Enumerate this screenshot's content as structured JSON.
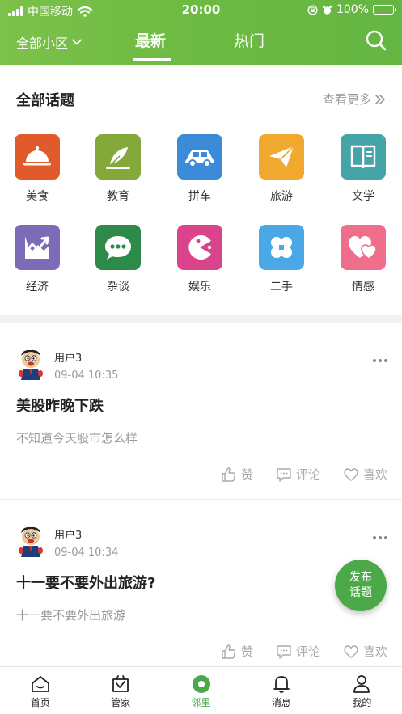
{
  "status_bar": {
    "carrier": "中国移动",
    "time": "20:00",
    "battery": "100%"
  },
  "header": {
    "community": "全部小区",
    "tabs": [
      {
        "label": "最新",
        "active": true
      },
      {
        "label": "热门",
        "active": false
      }
    ]
  },
  "topics": {
    "title": "全部话题",
    "see_more": "查看更多",
    "categories": [
      {
        "label": "美食",
        "icon": "cloche-icon",
        "color": "#e05a2b"
      },
      {
        "label": "教育",
        "icon": "feather-icon",
        "color": "#84a83a"
      },
      {
        "label": "拼车",
        "icon": "car-icon",
        "color": "#3b8bd9"
      },
      {
        "label": "旅游",
        "icon": "paper-plane-icon",
        "color": "#f0a92e"
      },
      {
        "label": "文学",
        "icon": "book-icon",
        "color": "#45a4a8"
      },
      {
        "label": "经济",
        "icon": "trend-chart-icon",
        "color": "#7c6bb6"
      },
      {
        "label": "杂谈",
        "icon": "chat-bubble-icon",
        "color": "#2e8a49"
      },
      {
        "label": "娱乐",
        "icon": "pacman-icon",
        "color": "#d9448a"
      },
      {
        "label": "二手",
        "icon": "clover-icon",
        "color": "#4aa8e6"
      },
      {
        "label": "情感",
        "icon": "hearts-icon",
        "color": "#ef6f8a"
      }
    ]
  },
  "posts": [
    {
      "user": "用户3",
      "time": "09-04 10:35",
      "title": "美股昨晚下跌",
      "body": "不知道今天股市怎么样",
      "actions": {
        "like": "赞",
        "comment": "评论",
        "favorite": "喜欢"
      }
    },
    {
      "user": "用户3",
      "time": "09-04 10:34",
      "title": "十一要不要外出旅游?",
      "body": "十一要不要外出旅游",
      "actions": {
        "like": "赞",
        "comment": "评论",
        "favorite": "喜欢"
      }
    }
  ],
  "fab": {
    "line1": "发布",
    "line2": "话题"
  },
  "bottom_nav": {
    "active_color": "#4ca94a",
    "items": [
      {
        "label": "首页",
        "icon": "home-icon"
      },
      {
        "label": "管家",
        "icon": "butler-icon"
      },
      {
        "label": "邻里",
        "icon": "neighbor-icon",
        "active": true
      },
      {
        "label": "消息",
        "icon": "bell-icon"
      },
      {
        "label": "我的",
        "icon": "person-icon"
      }
    ]
  }
}
